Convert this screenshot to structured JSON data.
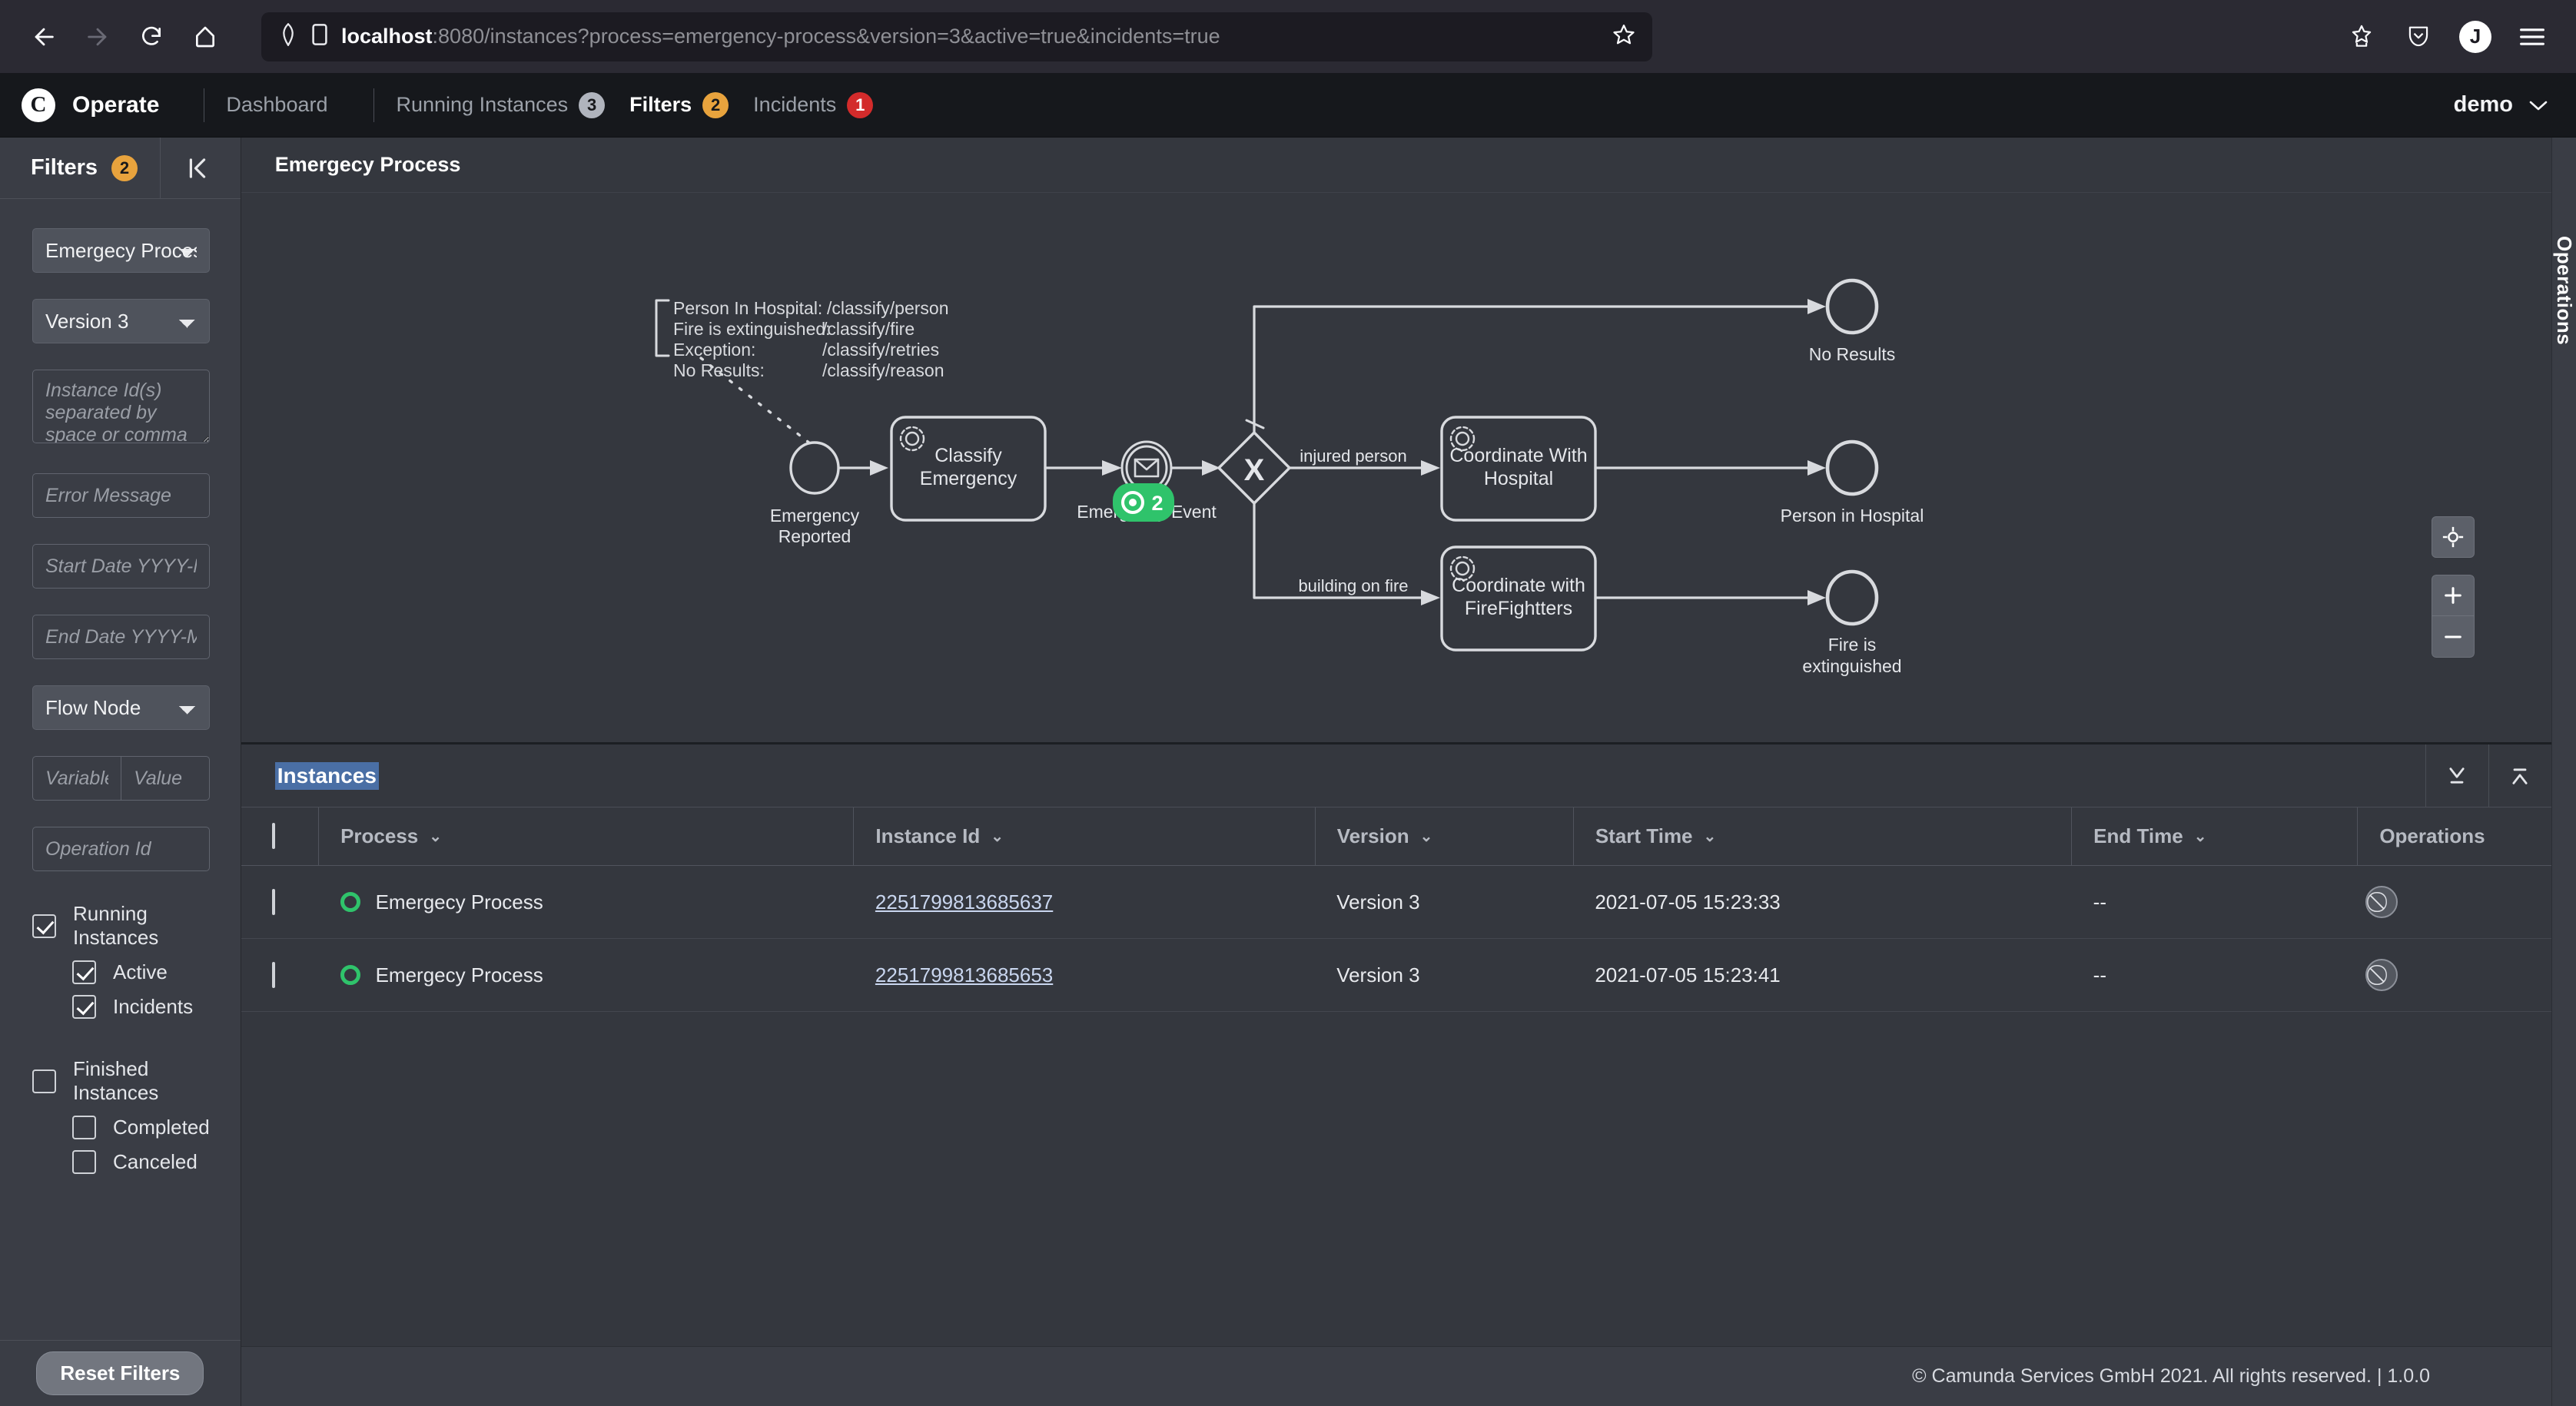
{
  "browser": {
    "back_icon": "back-arrow-icon",
    "forward_icon": "forward-arrow-icon",
    "reload_icon": "reload-icon",
    "home_icon": "home-icon",
    "shield_icon": "shield-icon",
    "page_icon": "page-icon",
    "url_host": "localhost",
    "url_rest": ":8080/instances?process=emergency-process&version=3&active=true&incidents=true",
    "bookmark_star_icon": "star-icon",
    "save_to_pocket_icon": "pocket-icon",
    "account_initial": "J",
    "menu_icon": "hamburger-menu-icon"
  },
  "app_header": {
    "logo_letter": "C",
    "brand": "Operate",
    "nav": [
      {
        "label": "Dashboard",
        "badge": null,
        "badge_color": null,
        "active": false
      },
      {
        "label": "Running Instances",
        "badge": "3",
        "badge_color": "#b0b4bd",
        "active": false
      },
      {
        "label": "Filters",
        "badge": "2",
        "badge_color": "#e8a33d",
        "active": true
      },
      {
        "label": "Incidents",
        "badge": "1",
        "badge_color": "#d32b2b",
        "active": false
      }
    ],
    "user": "demo",
    "user_caret_icon": "chevron-down-icon"
  },
  "sidebar": {
    "title": "Filters",
    "badge": "2",
    "collapse_icon": "collapse-panel-icon",
    "process_select": {
      "value": "Emergecy Process"
    },
    "version_select": {
      "value": "Version 3"
    },
    "instance_ids": {
      "placeholder": "Instance Id(s) separated by space or comma",
      "value": ""
    },
    "error_message": {
      "placeholder": "Error Message",
      "value": ""
    },
    "start_date": {
      "placeholder": "Start Date YYYY-MM-DD hh:mm:ss",
      "value": ""
    },
    "end_date": {
      "placeholder": "End Date YYYY-MM-DD hh:mm:ss",
      "value": ""
    },
    "flow_node_select": {
      "value": "Flow Node"
    },
    "variable": {
      "placeholder": "Variable",
      "value": ""
    },
    "value": {
      "placeholder": "Value",
      "value": ""
    },
    "operation_id": {
      "placeholder": "Operation Id",
      "value": ""
    },
    "checkboxes": [
      {
        "label": "Running Instances",
        "checked": true,
        "indent": false
      },
      {
        "label": "Active",
        "checked": true,
        "indent": true
      },
      {
        "label": "Incidents",
        "checked": true,
        "indent": true
      },
      {
        "label": "Finished Instances",
        "checked": false,
        "indent": false
      },
      {
        "label": "Completed",
        "checked": false,
        "indent": true
      },
      {
        "label": "Canceled",
        "checked": false,
        "indent": true
      }
    ],
    "reset_button": "Reset Filters"
  },
  "diagram": {
    "title": "Emergecy Process",
    "annotation": [
      {
        "key": "Person In Hospital:",
        "value": "/classify/person"
      },
      {
        "key": "Fire is extinguished:",
        "value": "/classify/fire"
      },
      {
        "key": "Exception:",
        "value": "/classify/retries"
      },
      {
        "key": "No Results:",
        "value": "/classify/reason"
      }
    ],
    "nodes": {
      "start_event": "Emergency Reported",
      "task_classify": "Classify Emergency",
      "message_event": "Emergency Event",
      "message_event_badge": "2",
      "gateway": "X",
      "end_no_results": "No Results",
      "task_hospital": "Coordinate With Hospital",
      "end_person_hospital": "Person in Hospital",
      "task_firefighters": "Coordinate with FireFightters",
      "end_fire_extinguished": "Fire is extinguished"
    },
    "flow_labels": {
      "injured_person": "injured person",
      "building_on_fire": "building on fire"
    },
    "badge_color": "#2fc36b",
    "zoom_controls": {
      "reset_icon": "crosshair-reset-zoom-icon",
      "zoom_in": "+",
      "zoom_out": "–"
    }
  },
  "instances_panel": {
    "title": "Instances",
    "title_selected": true,
    "action_icons": [
      {
        "name": "expand-down-icon"
      },
      {
        "name": "collapse-up-icon"
      }
    ],
    "columns": [
      {
        "label": "",
        "sortable": false
      },
      {
        "label": "Process",
        "sortable": true
      },
      {
        "label": "Instance Id",
        "sortable": true
      },
      {
        "label": "Version",
        "sortable": true
      },
      {
        "label": "Start Time",
        "sortable": true
      },
      {
        "label": "End Time",
        "sortable": true
      },
      {
        "label": "Operations",
        "sortable": false
      }
    ],
    "sort_caret": "⌄",
    "rows": [
      {
        "checked": false,
        "state": "active",
        "process": "Emergecy Process",
        "instance_id": "2251799813685637",
        "version": "Version 3",
        "start_time": "2021-07-05 15:23:33",
        "end_time": "--",
        "operation_icon": "cancel-operation-icon"
      },
      {
        "checked": false,
        "state": "active",
        "process": "Emergecy Process",
        "instance_id": "2251799813685653",
        "version": "Version 3",
        "start_time": "2021-07-05 15:23:41",
        "end_time": "--",
        "operation_icon": "cancel-operation-icon"
      }
    ]
  },
  "operations_rail": {
    "label": "Operations"
  },
  "footer": {
    "text": "© Camunda Services GmbH 2021. All rights reserved. | 1.0.0"
  }
}
